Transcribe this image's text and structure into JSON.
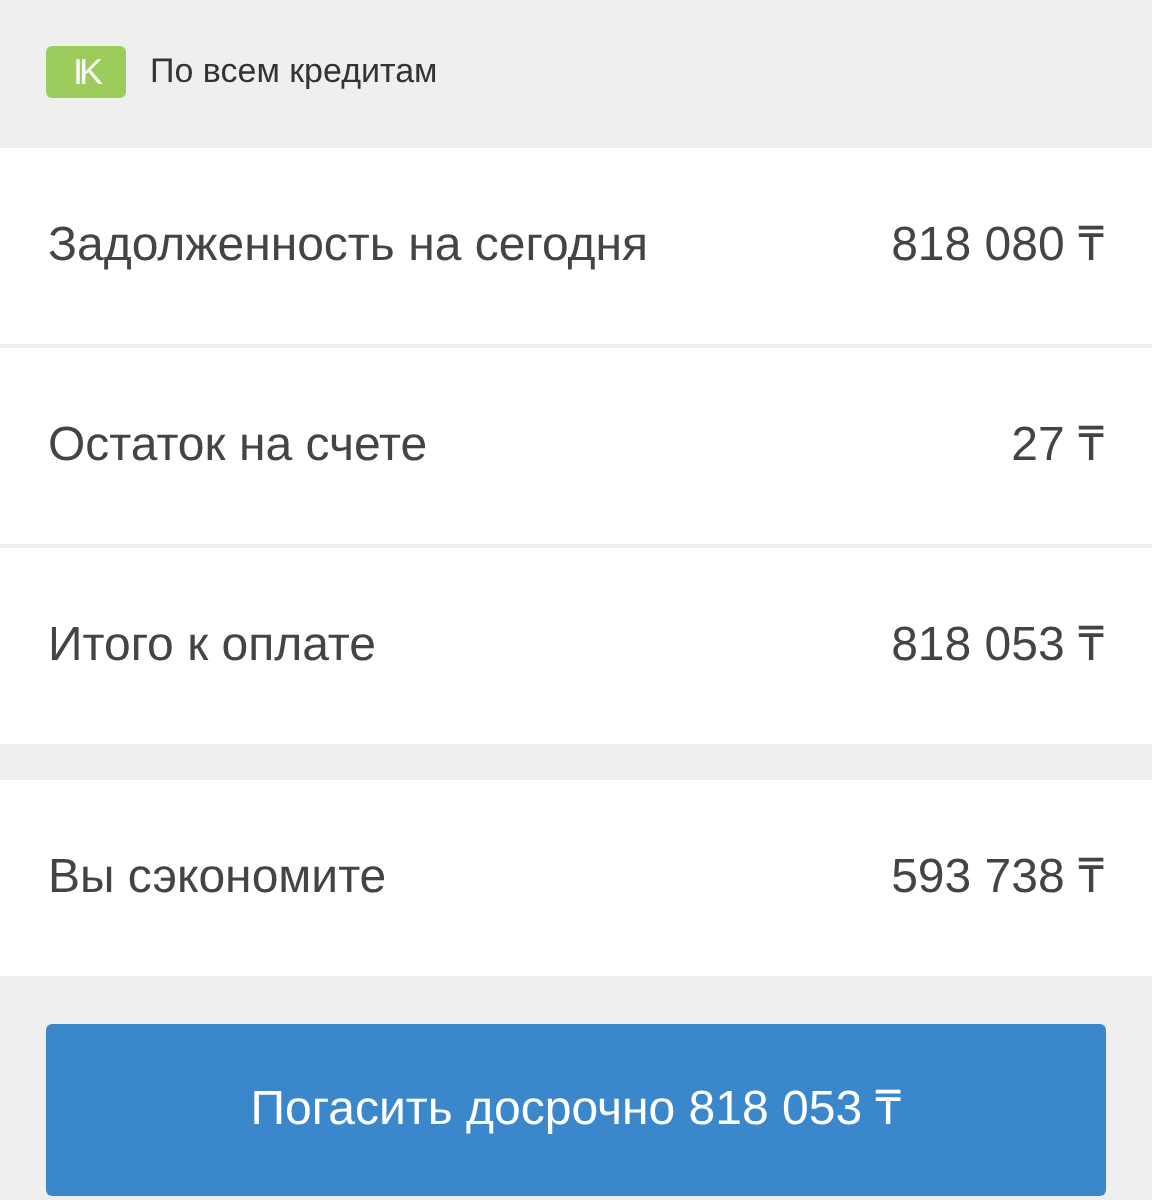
{
  "header": {
    "logo": "IK",
    "title": "По всем кредитам"
  },
  "summary": [
    {
      "label": "Задолженность на сегодня",
      "value": "818 080 ₸"
    },
    {
      "label": "Остаток на счете",
      "value": "27 ₸"
    },
    {
      "label": "Итого к оплате",
      "value": "818 053 ₸"
    }
  ],
  "savings": {
    "label": "Вы сэкономите",
    "value": "593 738 ₸"
  },
  "button": "Погасить досрочно 818 053 ₸"
}
